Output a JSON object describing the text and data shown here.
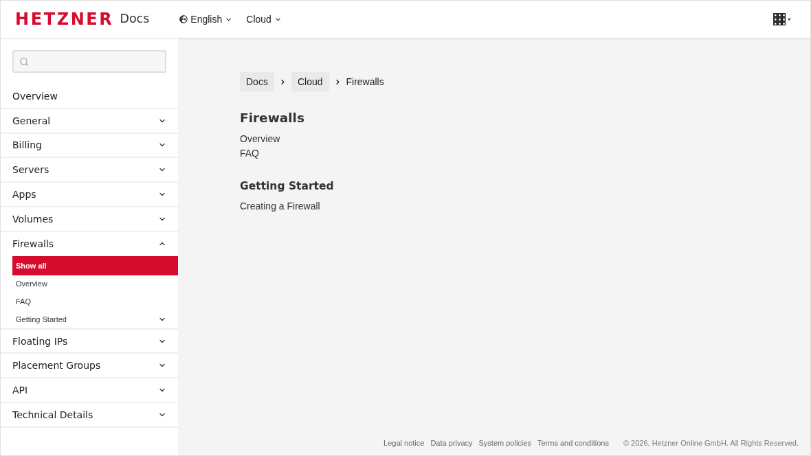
{
  "header": {
    "logo": "HETZNER",
    "product": "Docs",
    "menus": [
      {
        "label": "English",
        "kind": "language"
      },
      {
        "label": "Cloud",
        "kind": "plain"
      }
    ]
  },
  "sidebar": {
    "items": [
      {
        "label": "Overview",
        "kind": "link"
      },
      {
        "label": "General",
        "kind": "group",
        "expanded": false
      },
      {
        "label": "Billing",
        "kind": "group",
        "expanded": false
      },
      {
        "label": "Servers",
        "kind": "group",
        "expanded": false
      },
      {
        "label": "Apps",
        "kind": "group",
        "expanded": false
      },
      {
        "label": "Volumes",
        "kind": "group",
        "expanded": false
      },
      {
        "label": "Firewalls",
        "kind": "group",
        "expanded": true,
        "children": [
          {
            "label": "Show all",
            "kind": "link",
            "selected": true
          },
          {
            "label": "Overview",
            "kind": "link",
            "selected": false
          },
          {
            "label": "FAQ",
            "kind": "link",
            "selected": false
          },
          {
            "label": "Getting Started",
            "kind": "group",
            "selected": false,
            "expanded": false
          }
        ]
      },
      {
        "label": "Floating IPs",
        "kind": "group",
        "expanded": false
      },
      {
        "label": "Placement Groups",
        "kind": "group",
        "expanded": false
      },
      {
        "label": "API",
        "kind": "group",
        "expanded": false
      },
      {
        "label": "Technical Details",
        "kind": "group",
        "expanded": false
      }
    ]
  },
  "breadcrumbs": [
    {
      "label": "Docs",
      "current": false
    },
    {
      "label": "Cloud",
      "current": false
    },
    {
      "label": "Firewalls",
      "current": true
    }
  ],
  "page": {
    "title": "Firewalls",
    "sections": [
      {
        "links": [
          "Overview",
          "FAQ"
        ]
      },
      {
        "heading": "Getting Started",
        "links": [
          "Creating a Firewall"
        ]
      }
    ]
  },
  "footer": {
    "links": [
      "Legal notice",
      "Data privacy",
      "System policies",
      "Terms and conditions"
    ],
    "copyright": "© 2026. Hetzner Online GmbH. All Rights Reserved."
  }
}
